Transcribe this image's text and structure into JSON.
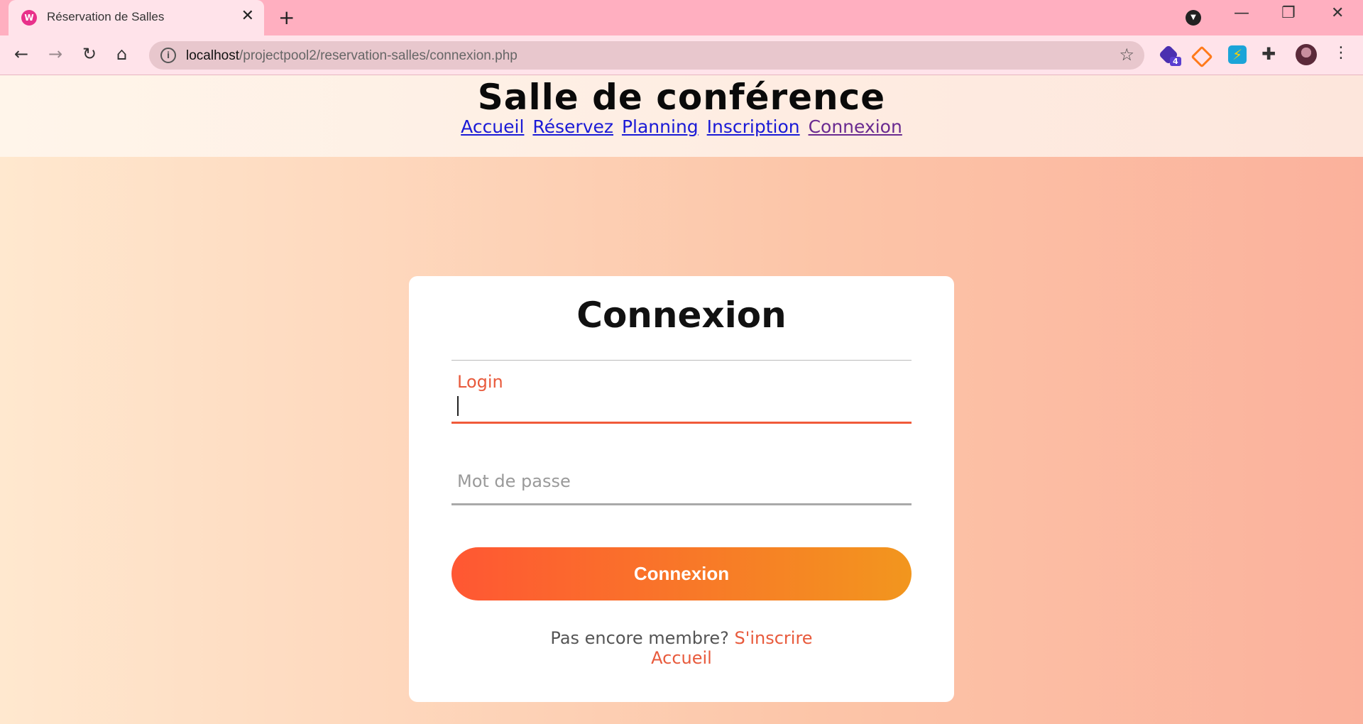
{
  "browser": {
    "tab_title": "Réservation de Salles",
    "favicon_glyph": "W",
    "url_host": "localhost",
    "url_path": "/projectpool2/reservation-salles/connexion.php",
    "extension_badge": "4"
  },
  "site": {
    "title": "Salle de conférence",
    "nav": [
      "Accueil",
      "Réservez",
      "Planning",
      "Inscription",
      "Connexion"
    ]
  },
  "form": {
    "heading": "Connexion",
    "login_label": "Login",
    "login_value": "",
    "password_placeholder": "Mot de passe",
    "submit_label": "Connexion",
    "signup_prompt": "Pas encore membre?",
    "signup_link": "S'inscrire",
    "home_link": "Accueil"
  },
  "colors": {
    "accent": "#e85a3c",
    "button_gradient_start": "#ff5733",
    "button_gradient_end": "#f2961e",
    "tab_bar": "#ffafc0"
  }
}
